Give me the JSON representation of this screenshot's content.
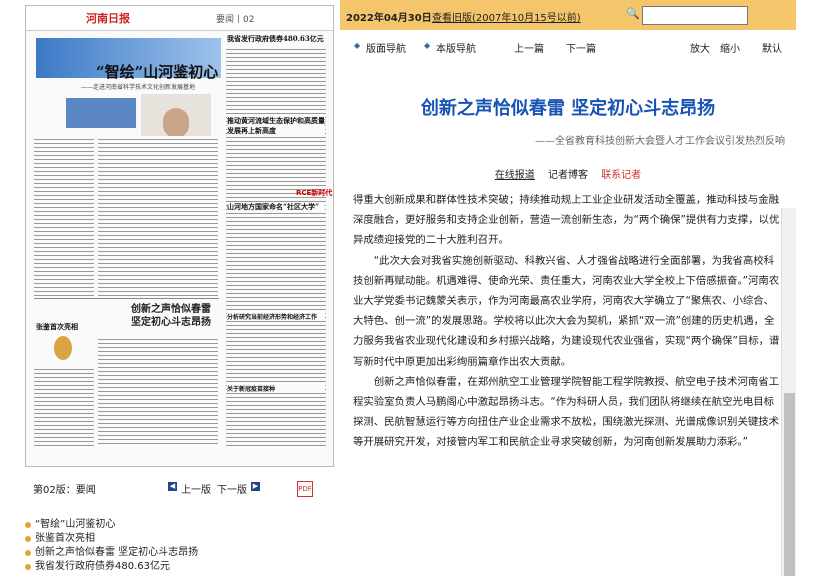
{
  "toolbar": {
    "date": "2022年04月30日",
    "history_link": "查看旧版(2007年10月15号以前)",
    "search_value": ""
  },
  "nav": {
    "layout_nav": "版面导航",
    "issue_nav": "本版导航",
    "prev_article": "上一篇",
    "next_article": "下一篇",
    "zoom_in": "放大",
    "zoom_out": "缩小",
    "default": "默认"
  },
  "newspaper_thumb": {
    "masthead": "河南日报",
    "page_label": "要闻丨02",
    "headline_main": "“智绘”山河鉴初心",
    "subline_main": "——走进河南省科学技术文化创新发展基地",
    "right_title_1": "我省发行政府债券480.63亿元",
    "right_title_2": "推动黄河流域生态保护和高质量发展再上新高度",
    "right_title_3": "山河地方国家命名“社区大学”",
    "right_title_4": "分析研究当前经济形势和经济工作",
    "right_title_5": "关于新冠疫苗接种",
    "red_tag": "RCE新时代",
    "headline_second": "创新之声恰似春雷 坚定初心斗志昂扬",
    "left_small": "张鉴首次亮相"
  },
  "page_bar": {
    "page_name": "第02版：要闻",
    "prev_page": "上一版",
    "next_page": "下一版",
    "pdf_icon_text": "PDF"
  },
  "title_list": [
    "“智绘”山河鉴初心",
    "张鉴首次亮相",
    "创新之声恰似春雷 坚定初心斗志昂扬",
    "我省发行政府债券480.63亿元"
  ],
  "article": {
    "headline": "创新之声恰似春雷 坚定初心斗志昂扬",
    "subheadline": "——全省教育科技创新大会暨人才工作会议引发热烈反响",
    "byline_1": "在线报道",
    "byline_2": "记者博客",
    "byline_3": "联系记者",
    "paragraphs": [
      "得重大创新成果和群体性技术突破；持续推动规上工业企业研发活动全覆盖，推动科技与金融深度融合，更好服务和支持企业创新，营造一流创新生态，为“两个确保”提供有力支撑，以优异成绩迎接党的二十大胜利召开。",
      "“此次大会对我省实施创新驱动、科教兴省、人才强省战略进行全面部署，为我省高校科技创新再赋动能。机遇难得、使命光荣、责任重大，河南农业大学全校上下倍感振奋。”河南农业大学党委书记魏蒙关表示，作为河南最高农业学府，河南农大学确立了“聚焦农、小综合、大特色、创一流”的发展思路。学校将以此次大会为契机，紧抓“双一流”创建的历史机遇，全力服务我省农业现代化建设和乡村振兴战略，为建设现代农业强省，实现“两个确保”目标，谱写新时代中原更加出彩绚丽篇章作出农大贡献。",
      "创新之声恰似春雷，在郑州航空工业管理学院智能工程学院教授、航空电子技术河南省工程实验室负责人马鹏阁心中激起昂扬斗志。“作为科研人员，我们团队将继续在航空光电目标探测、民航智慧运行等方向扭住产业企业需求不放松，围绕激光探测、光谱成像识别关键技术等开展研究开发，对接管内军工和民航企业寻求突破创新，为河南创新发展助力添彩。”"
    ]
  }
}
